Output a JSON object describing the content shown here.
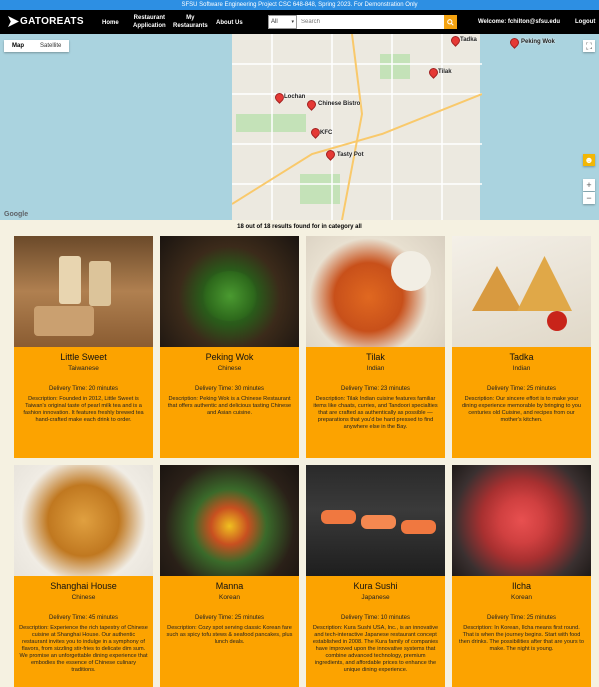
{
  "banner": "SFSU Software Engineering Project CSC 648-848, Spring 2023. For Demonstration Only",
  "nav": {
    "logo": "GATOREATS",
    "home": "Home",
    "restaurant_app_1": "Restaurant",
    "restaurant_app_2": "Application",
    "my_restaurants_1": "My",
    "my_restaurants_2": "Restaurants",
    "about": "About Us",
    "search_select": "All",
    "search_placeholder": "Search",
    "welcome": "Welcome: fchilton@sfsu.edu",
    "logout": "Logout"
  },
  "map": {
    "tab_map": "Map",
    "tab_satellite": "Satellite",
    "google": "Google",
    "pins": [
      "Tadka",
      "Peking Wok",
      "Tilak",
      "Lochan",
      "Chinese Bistro",
      "Tasty Pot",
      "KFC"
    ]
  },
  "results_text": "18 out of 18 results found for in category all",
  "restaurants": [
    {
      "name": "Little Sweet",
      "cuisine": "Taiwanese",
      "delivery": "Delivery Time: 20 minutes",
      "description": "Description: Founded in 2012, Little Sweet is Taiwan's original taste of pearl milk tea and is a fashion innovation. It features freshly brewed tea hand-crafted make each drink to order."
    },
    {
      "name": "Peking Wok",
      "cuisine": "Chinese",
      "delivery": "Delivery Time: 30 minutes",
      "description": "Description: Peking Wok is a Chinese Restaurant that offers authentic and delicious tasting Chinese and Asian cuisine."
    },
    {
      "name": "Tilak",
      "cuisine": "Indian",
      "delivery": "Delivery Time: 23 minutes",
      "description": "Description: Tilak Indian cuisine features familiar items like chaats, curries, and Tandoori specialties that are crafted as authentically as possible — preparations that you'd be hard pressed to find anywhere else in the Bay."
    },
    {
      "name": "Tadka",
      "cuisine": "Indian",
      "delivery": "Delivery Time: 25 minutes",
      "description": "Description: Our sincere effort is to make your dining experience memorable by bringing to you centuries old Cuisine, and recipes from our mother's kitchen."
    },
    {
      "name": "Shanghai House",
      "cuisine": "Chinese",
      "delivery": "Delivery Time: 45 minutes",
      "description": "Description: Experience the rich tapestry of Chinese cuisine at Shanghai House. Our authentic restaurant invites you to indulge in a symphony of flavors, from sizzling stir-fries to delicate dim sum. We promise an unforgettable dining experience that embodies the essence of Chinese culinary traditions."
    },
    {
      "name": "Manna",
      "cuisine": "Korean",
      "delivery": "Delivery Time: 25 minutes",
      "description": "Description: Cozy spot serving classic Korean fare such as spicy tofu stews & seafood pancakes, plus lunch deals."
    },
    {
      "name": "Kura Sushi",
      "cuisine": "Japanese",
      "delivery": "Delivery Time: 10 minutes",
      "description": "Description: Kura Sushi USA, Inc., is an innovative and tech-interactive Japanese restaurant concept established in 2008. The Kura family of companies have improved upon the innovative systems that combine advanced technology, premium ingredients, and affordable prices to enhance the unique dining experience."
    },
    {
      "name": "Ilcha",
      "cuisine": "Korean",
      "delivery": "Delivery Time: 25 minutes",
      "description": "Description: In Korean, Ilcha means first round. That is when the journey begins. Start with food then drinks. The possibilities after that are yours to make. The night is young."
    }
  ]
}
